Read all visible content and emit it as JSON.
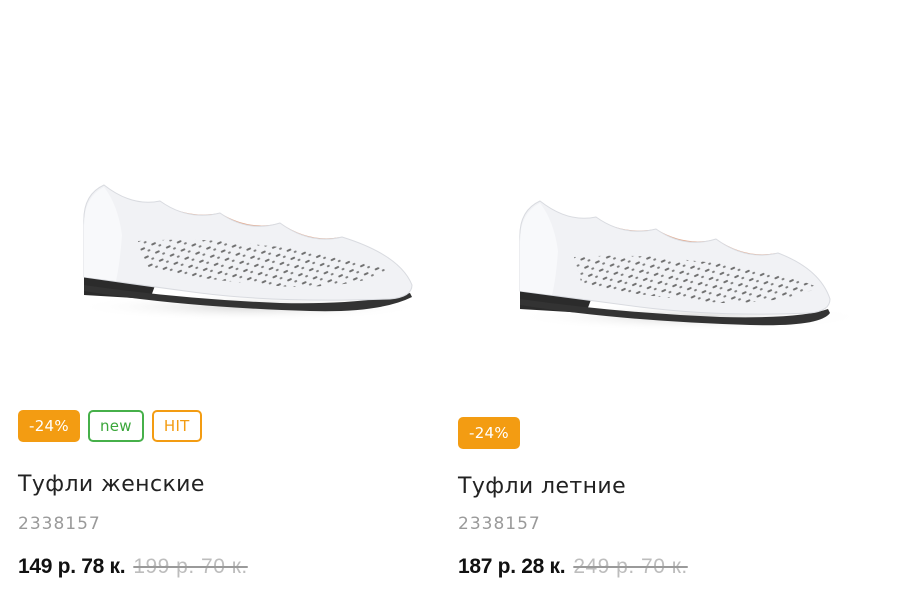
{
  "products": [
    {
      "image_alt": "white-perforated-ballet-flat",
      "badges": {
        "sale": "-24%",
        "new": "new",
        "hit": "HIT"
      },
      "title": "Туфли женские",
      "sku": "2338157",
      "price_current": "149 р. 78 к.",
      "price_old": "199 р. 70 к."
    },
    {
      "image_alt": "white-perforated-ballet-flat",
      "badges": {
        "sale": "-24%"
      },
      "title": "Туфли летние",
      "sku": "2338157",
      "price_current": "187 р. 28 к.",
      "price_old": "249 р. 70 к."
    }
  ],
  "colors": {
    "sale_badge": "#f39c12",
    "new_badge": "#46b04a",
    "hit_badge": "#f39c12",
    "old_price": "#bdbdbd",
    "sku": "#9a9a9a"
  }
}
